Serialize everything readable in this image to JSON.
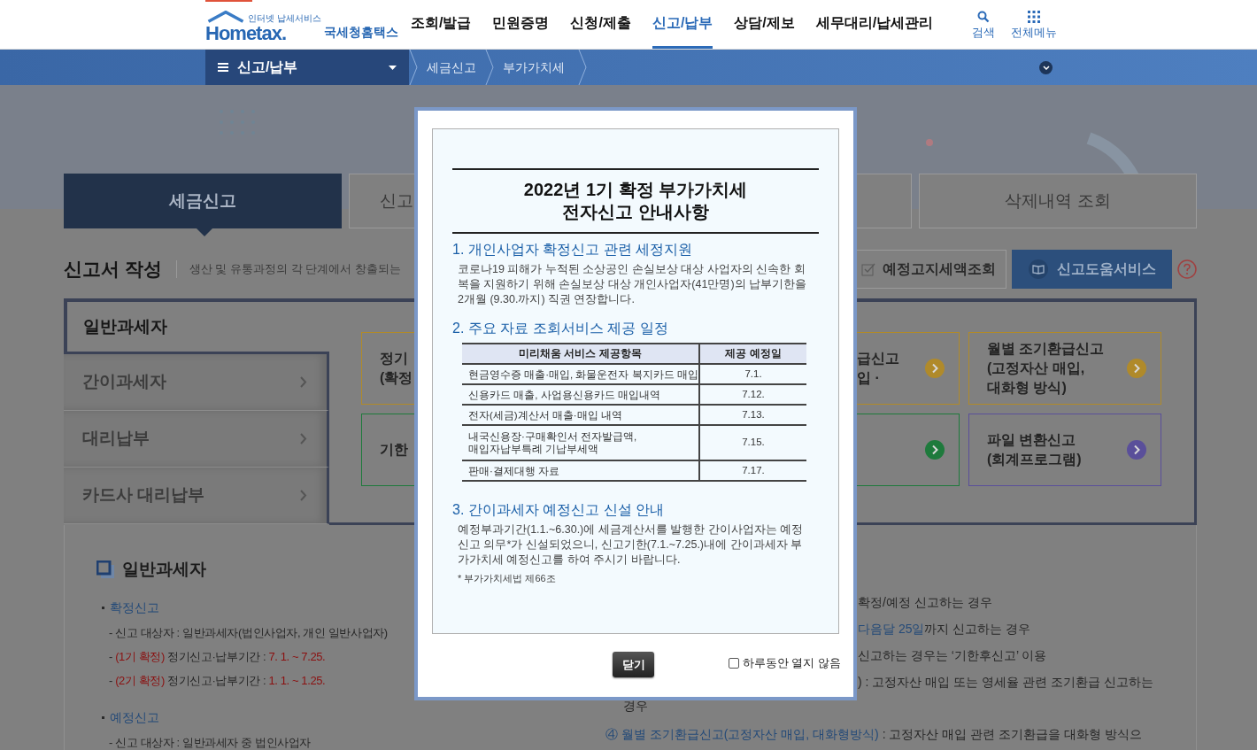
{
  "header": {
    "logo": {
      "tagline": "인터넷 납세서비스",
      "name": "Hometax.",
      "korean_name": "국세청홈택스"
    },
    "menu": [
      {
        "label": "조회/발급",
        "selected": false
      },
      {
        "label": "민원증명",
        "selected": false
      },
      {
        "label": "신청/제출",
        "selected": false
      },
      {
        "label": "신고/납부",
        "selected": true
      },
      {
        "label": "상담/제보",
        "selected": false
      },
      {
        "label": "세무대리/납세관리",
        "selected": false
      }
    ],
    "actions": [
      {
        "kind": "search",
        "label": "검색"
      },
      {
        "kind": "grid",
        "label": "전체메뉴"
      }
    ]
  },
  "nav_bar": {
    "section": "신고/납부",
    "breadcrumbs": [
      "세금신고",
      "부가가치세"
    ]
  },
  "tabs": [
    {
      "label": "세금신고",
      "selected": true
    },
    {
      "label": "신고",
      "selected": false
    },
    {
      "label": "삭제내역 조회",
      "selected": false
    }
  ],
  "form_header": {
    "title": "신고서 작성",
    "description": "생산 및 유통과정의 각 단계에서 창출되는",
    "buttons": [
      {
        "kind": "check",
        "label": "예정고지세액조회"
      },
      {
        "kind": "book",
        "label": "신고도움서비스"
      }
    ]
  },
  "taxpayer_types": [
    {
      "label": "일반과세자",
      "selected": true
    },
    {
      "label": "간이과세자",
      "selected": false
    },
    {
      "label": "대리납부",
      "selected": false
    },
    {
      "label": "카드사 대리납부",
      "selected": false
    }
  ],
  "cards": [
    {
      "lines": [
        "정기",
        "(확정"
      ],
      "color": "#b08a2a",
      "arrow": false
    },
    {
      "lines": [
        "급신고",
        "입 ·"
      ],
      "color": "#b08a2a",
      "arrow": true
    },
    {
      "lines": [
        "월별 조기환급신고",
        "(고정자산 매입,",
        "대화형 방식)"
      ],
      "color": "#b08a2a",
      "arrow": true
    },
    {
      "lines": [
        "기한"
      ],
      "color": "#1e7a3c",
      "arrow": false
    },
    {
      "color": "#1e7a3c",
      "arrow": true
    },
    {
      "lines": [
        "파일 변환신고",
        "(회계프로그램)"
      ],
      "color": "#5a4f9a",
      "arrow": true
    }
  ],
  "guide": {
    "title": "일반과세자",
    "sections": [
      {
        "title": "확정신고",
        "items": [
          {
            "parts": [
              {
                "text": "- 신고 대상자 : 일반과세자(법인사업자, 개인 일반사업자)"
              }
            ]
          },
          {
            "parts": [
              {
                "text": "-"
              },
              {
                "text": "(1기 확정)",
                "kind": "accent"
              },
              {
                "text": "정기신고·납부기간 :"
              },
              {
                "text": "7. 1. ~ 7.25.",
                "kind": "accent"
              }
            ]
          },
          {
            "parts": [
              {
                "text": "-"
              },
              {
                "text": "(2기 확정)",
                "kind": "accent"
              },
              {
                "text": "정기신고·납부기간 :"
              },
              {
                "text": "1. 1. ~ 1.25.",
                "kind": "accent"
              }
            ]
          }
        ]
      },
      {
        "title": "예정신고",
        "items": [
          {
            "parts": [
              {
                "text": "- 신고 대상자 : 일반과세자 중 법인사업자"
              }
            ]
          }
        ]
      }
    ],
    "right_lines": [
      {
        "text": "확정/예정 신고하는 경우"
      },
      {
        "highlight": "다음달 25일",
        "text": "까지 신고하는 경우"
      },
      {
        "text": "신고하는 경우는 ‘기한후신고’ 이용"
      },
      {
        "text": ") : 고정자산 매입 또는 영세율 관련 조기환급 신고하는"
      }
    ],
    "bottom_lines": [
      {
        "text": "경우"
      },
      {
        "highlight": "④ 월별 조기환급신고(고정자산 매입, 대화형방식)",
        "text": " : 고정자산 매입 관련 조기환급을 대화형 방식으"
      }
    ]
  },
  "notice": {
    "title_lines": [
      "2022년 1기 확정 부가가치세",
      "전자신고 안내사항"
    ],
    "sections": [
      {
        "heading": "1. 개인사업자 확정신고 관련 세정지원",
        "body": "코로나19 피해가 누적된 소상공인 손실보상 대상 사업자의 신속한 회복을 지원하기 위해 손실보상 대상 개인사업자(41만명)의 납부기한을 2개월 (9.30.까지) 직권 연장합니다."
      },
      {
        "heading": "2. 주요 자료 조회서비스 제공 일정",
        "table": {
          "columns": [
            "미리채움 서비스 제공항목",
            "제공 예정일"
          ],
          "rows": [
            [
              "현금영수증 매출·매입, 화물운전자 복지카드 매입",
              "7.1."
            ],
            [
              "신용카드 매출, 사업용신용카드 매입내역",
              "7.12."
            ],
            [
              "전자(세금)계산서 매출·매입 내역",
              "7.13."
            ],
            [
              "내국신용장·구매확인서 전자발급액,\n매입자납부특례 기납부세액",
              "7.15."
            ],
            [
              "판매·결제대행 자료",
              "7.17."
            ]
          ]
        }
      },
      {
        "heading": "3. 간이과세자 예정신고 신설 안내",
        "body": "예정부과기간(1.1.~6.30.)에 세금계산서를 발행한 간이사업자는 예정신고 의무*가 신설되었으니, 신고기한(7.1.~7.25.)내에 간이과세자 부가가치세 예정신고를 하여 주시기 바랍니다.",
        "note": "* 부가가치세법 제66조"
      }
    ],
    "close_button": "닫기",
    "dont_show_today": {
      "label": "하루동안 열지 않음",
      "checked": false
    }
  }
}
